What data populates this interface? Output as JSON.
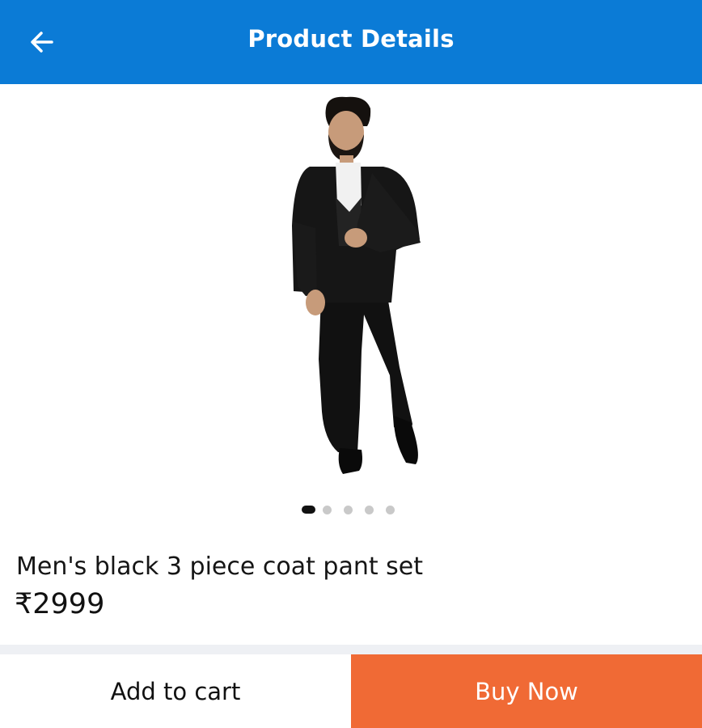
{
  "header": {
    "title": "Product Details",
    "back_icon": "arrow-left-icon",
    "background": "#0B7BD6"
  },
  "product": {
    "name": "Men's black 3 piece coat pant set",
    "price": "₹2999",
    "image_description": "man-in-black-three-piece-suit"
  },
  "carousel": {
    "total_images": 5,
    "active_index": 0
  },
  "actions": {
    "add_to_cart_label": "Add to cart",
    "buy_now_label": "Buy Now",
    "buy_now_color": "#F06A35"
  }
}
